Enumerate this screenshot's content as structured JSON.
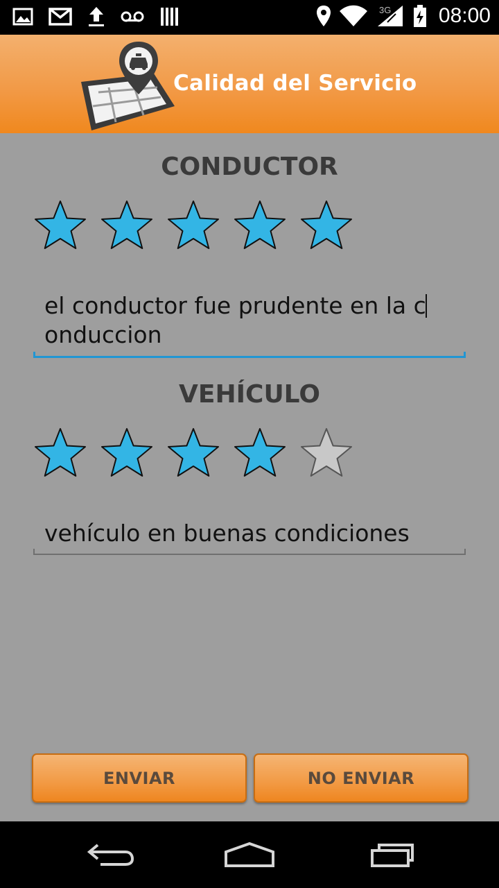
{
  "status_bar": {
    "time": "08:00",
    "network": "3G",
    "icons": [
      "image-icon",
      "gmail-icon",
      "upload-icon",
      "voicemail-icon",
      "storage-icon",
      "location-icon",
      "wifi-icon",
      "signal-icon",
      "battery-icon"
    ]
  },
  "header": {
    "title": "Calidad del Servicio",
    "logo": "taxi-map-pin-logo",
    "accent_color": "#f29a47"
  },
  "conductor": {
    "title": "CONDUCTOR",
    "rating": 5,
    "max_rating": 5,
    "comment_before_caret": "el conductor fue prudente en la c",
    "comment_after_caret": "onduccion"
  },
  "vehiculo": {
    "title": "VEHÍCULO",
    "rating": 4,
    "max_rating": 5,
    "comment": "vehículo en buenas condiciones"
  },
  "buttons": {
    "send": "ENVIAR",
    "cancel": "NO ENVIAR"
  },
  "colors": {
    "star_filled": "#33b5e5",
    "star_empty": "#c8c8c8",
    "background": "#9e9e9e",
    "focus_underline": "#2196d3"
  },
  "nav_bar": [
    "back-icon",
    "home-icon",
    "recents-icon"
  ]
}
